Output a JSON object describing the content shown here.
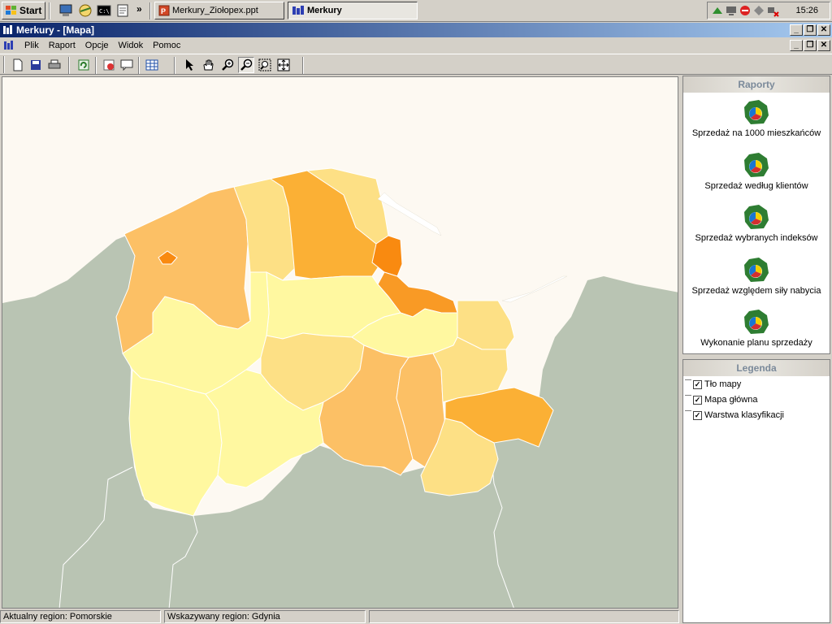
{
  "taskbar": {
    "start_label": "Start",
    "chevron": "»",
    "tasks": [
      {
        "label": "Merkury_Ziołopex.ppt"
      },
      {
        "label": "Merkury"
      }
    ],
    "clock": "15:26"
  },
  "window": {
    "title": "Merkury - [Mapa]",
    "controls": {
      "minimize": "_",
      "restore": "❐",
      "close": "✕"
    }
  },
  "menu": {
    "items": [
      "Plik",
      "Raport",
      "Opcje",
      "Widok",
      "Pomoc"
    ]
  },
  "toolbar": {
    "icons": [
      "new-icon",
      "save-icon",
      "print-icon",
      "refresh-icon",
      "delete-icon",
      "comment-icon",
      "table-icon",
      "pointer-icon",
      "hand-icon",
      "zoom-in-icon",
      "zoom-out-icon",
      "zoom-window-icon",
      "zoom-extent-icon"
    ]
  },
  "reports_panel": {
    "title": "Raporty",
    "items": [
      {
        "label": "Sprzedaż na 1000 mieszkańców"
      },
      {
        "label": "Sprzedaż według klientów"
      },
      {
        "label": "Sprzedaż wybranych indeksów"
      },
      {
        "label": "Sprzedaż względem siły nabycia"
      },
      {
        "label": "Wykonanie planu sprzedaży"
      }
    ]
  },
  "legend_panel": {
    "title": "Legenda",
    "items": [
      {
        "label": "Tło mapy",
        "checked": "✓"
      },
      {
        "label": "Mapa główna",
        "checked": "✓"
      },
      {
        "label": "Warstwa klasyfikacji",
        "checked": "✓"
      }
    ]
  },
  "statusbar": {
    "current_region": "Aktualny region: Pomorskie",
    "pointed_region": "Wskazywany region: Gdynia"
  },
  "colors": {
    "map_bg": "#fdf9f2",
    "land_grey": "#b9c4b3",
    "class_light": "#fff8a0",
    "class_mid": "#fde085",
    "class_orange": "#fcc065",
    "class_dark": "#fbb035",
    "class_darkest": "#f98a10"
  }
}
